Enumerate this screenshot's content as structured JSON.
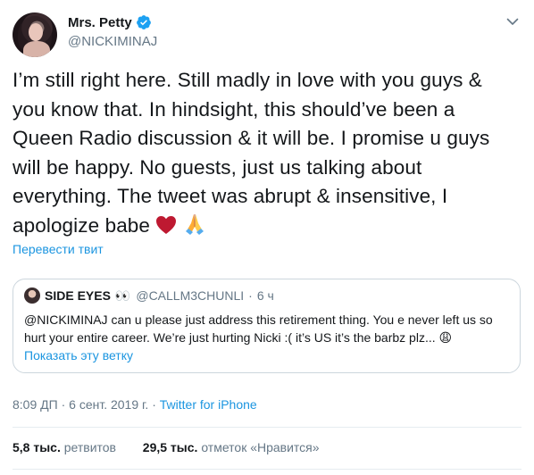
{
  "author": {
    "display_name": "Mrs. Petty",
    "handle": "@NICKIMINAJ",
    "verified": true
  },
  "tweet": {
    "text_main": "I’m still right here. Still madly in love with you guys & you know that. In hindsight, this should’ve been a Queen Radio discussion & it will be. I promise u guys will be happy. No guests, just us talking about everything. The tweet was abrupt & insensitive, I apologize babe",
    "emoji_heart": "♥",
    "emoji_hands": "🙏",
    "translate_label": "Перевести твит"
  },
  "quoted": {
    "display_name": "SIDE EYES",
    "name_emoji": "👀",
    "handle": "@CALLM3CHUNLI",
    "separator": "·",
    "time": "6 ч",
    "text": "@NICKIMINAJ can u please just address this retirement thing. You e never left us so hurt your entire career. We’re just hurting Nicki :( it’s US it’s the barbz plz...",
    "end_emoji": "😩",
    "show_thread_label": "Показать эту ветку"
  },
  "meta": {
    "time": "8:09 ДП",
    "separator1": "·",
    "date": "6 сент. 2019 г.",
    "separator2": "·",
    "source": "Twitter for iPhone"
  },
  "stats": {
    "retweets_count": "5,8 тыс.",
    "retweets_label": "ретвитов",
    "likes_count": "29,5 тыс.",
    "likes_label": "отметок «Нравится»"
  },
  "colors": {
    "link": "#1b95e0",
    "secondary_text": "#657786",
    "border": "#ccd6dd",
    "heart": "#be1931"
  },
  "icons": {
    "verified": "verified-badge-icon",
    "caret": "chevron-down-icon"
  }
}
